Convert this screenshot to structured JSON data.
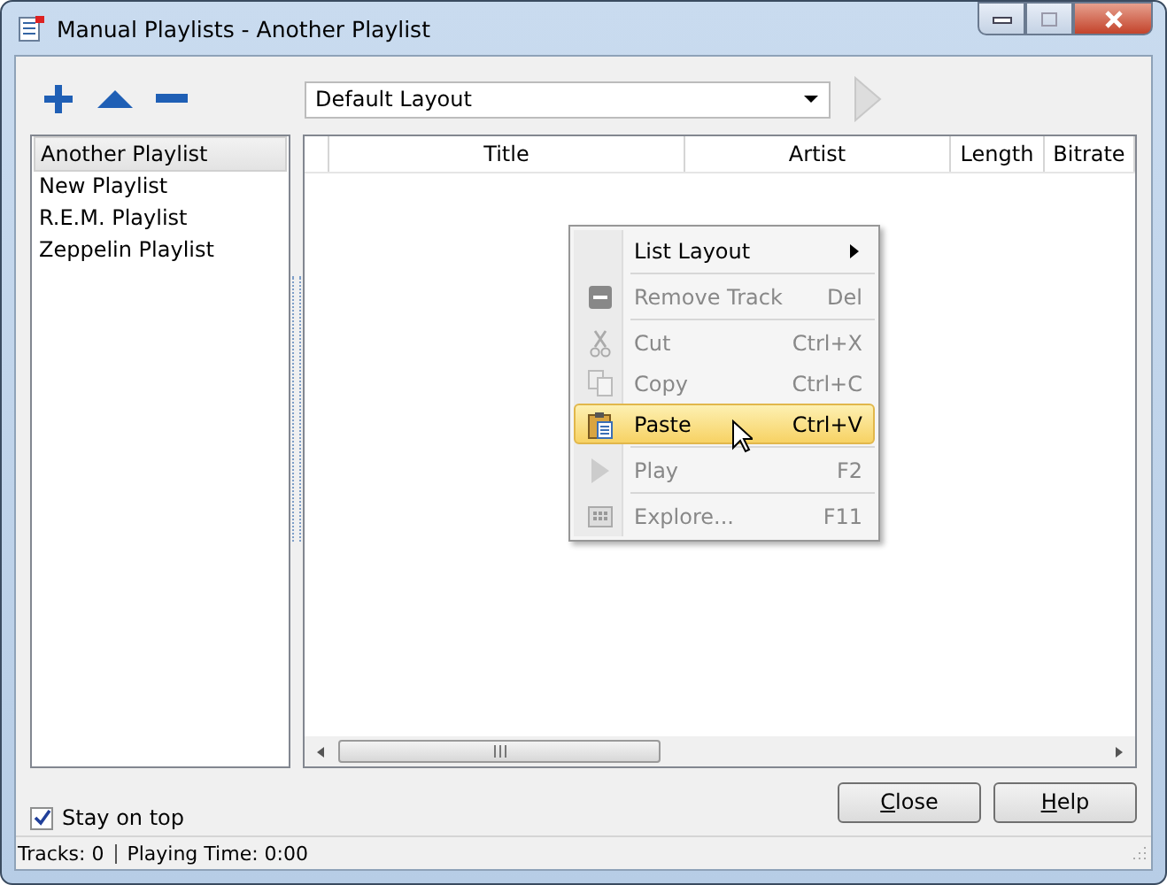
{
  "window": {
    "title": "Manual Playlists - Another Playlist"
  },
  "layout_select": {
    "value": "Default Layout"
  },
  "playlists": [
    {
      "label": "Another Playlist",
      "selected": true
    },
    {
      "label": "New Playlist",
      "selected": false
    },
    {
      "label": "R.E.M. Playlist",
      "selected": false
    },
    {
      "label": "Zeppelin Playlist",
      "selected": false
    }
  ],
  "table": {
    "columns": [
      "Title",
      "Artist",
      "Length",
      "Bitrate"
    ]
  },
  "context_menu": [
    {
      "kind": "submenu",
      "label": "List Layout",
      "disabled": false,
      "selected": false
    },
    {
      "kind": "separator"
    },
    {
      "kind": "item",
      "label": "Remove Track",
      "shortcut": "Del",
      "disabled": true,
      "selected": false
    },
    {
      "kind": "separator"
    },
    {
      "kind": "item",
      "label": "Cut",
      "shortcut": "Ctrl+X",
      "disabled": true,
      "selected": false
    },
    {
      "kind": "item",
      "label": "Copy",
      "shortcut": "Ctrl+C",
      "disabled": true,
      "selected": false
    },
    {
      "kind": "item",
      "label": "Paste",
      "shortcut": "Ctrl+V",
      "disabled": false,
      "selected": true
    },
    {
      "kind": "separator"
    },
    {
      "kind": "item",
      "label": "Play",
      "shortcut": "F2",
      "disabled": true,
      "selected": false
    },
    {
      "kind": "separator"
    },
    {
      "kind": "item",
      "label": "Explore...",
      "shortcut": "F11",
      "disabled": true,
      "selected": false
    }
  ],
  "stay_on_top": {
    "label": "Stay on top",
    "checked": true
  },
  "buttons": [
    {
      "label": "Close",
      "first_letter_underlined": true
    },
    {
      "label": "Help",
      "first_letter_underlined": true
    }
  ],
  "status_bar": [
    "Tracks: 0",
    "Playing Time: 0:00"
  ]
}
